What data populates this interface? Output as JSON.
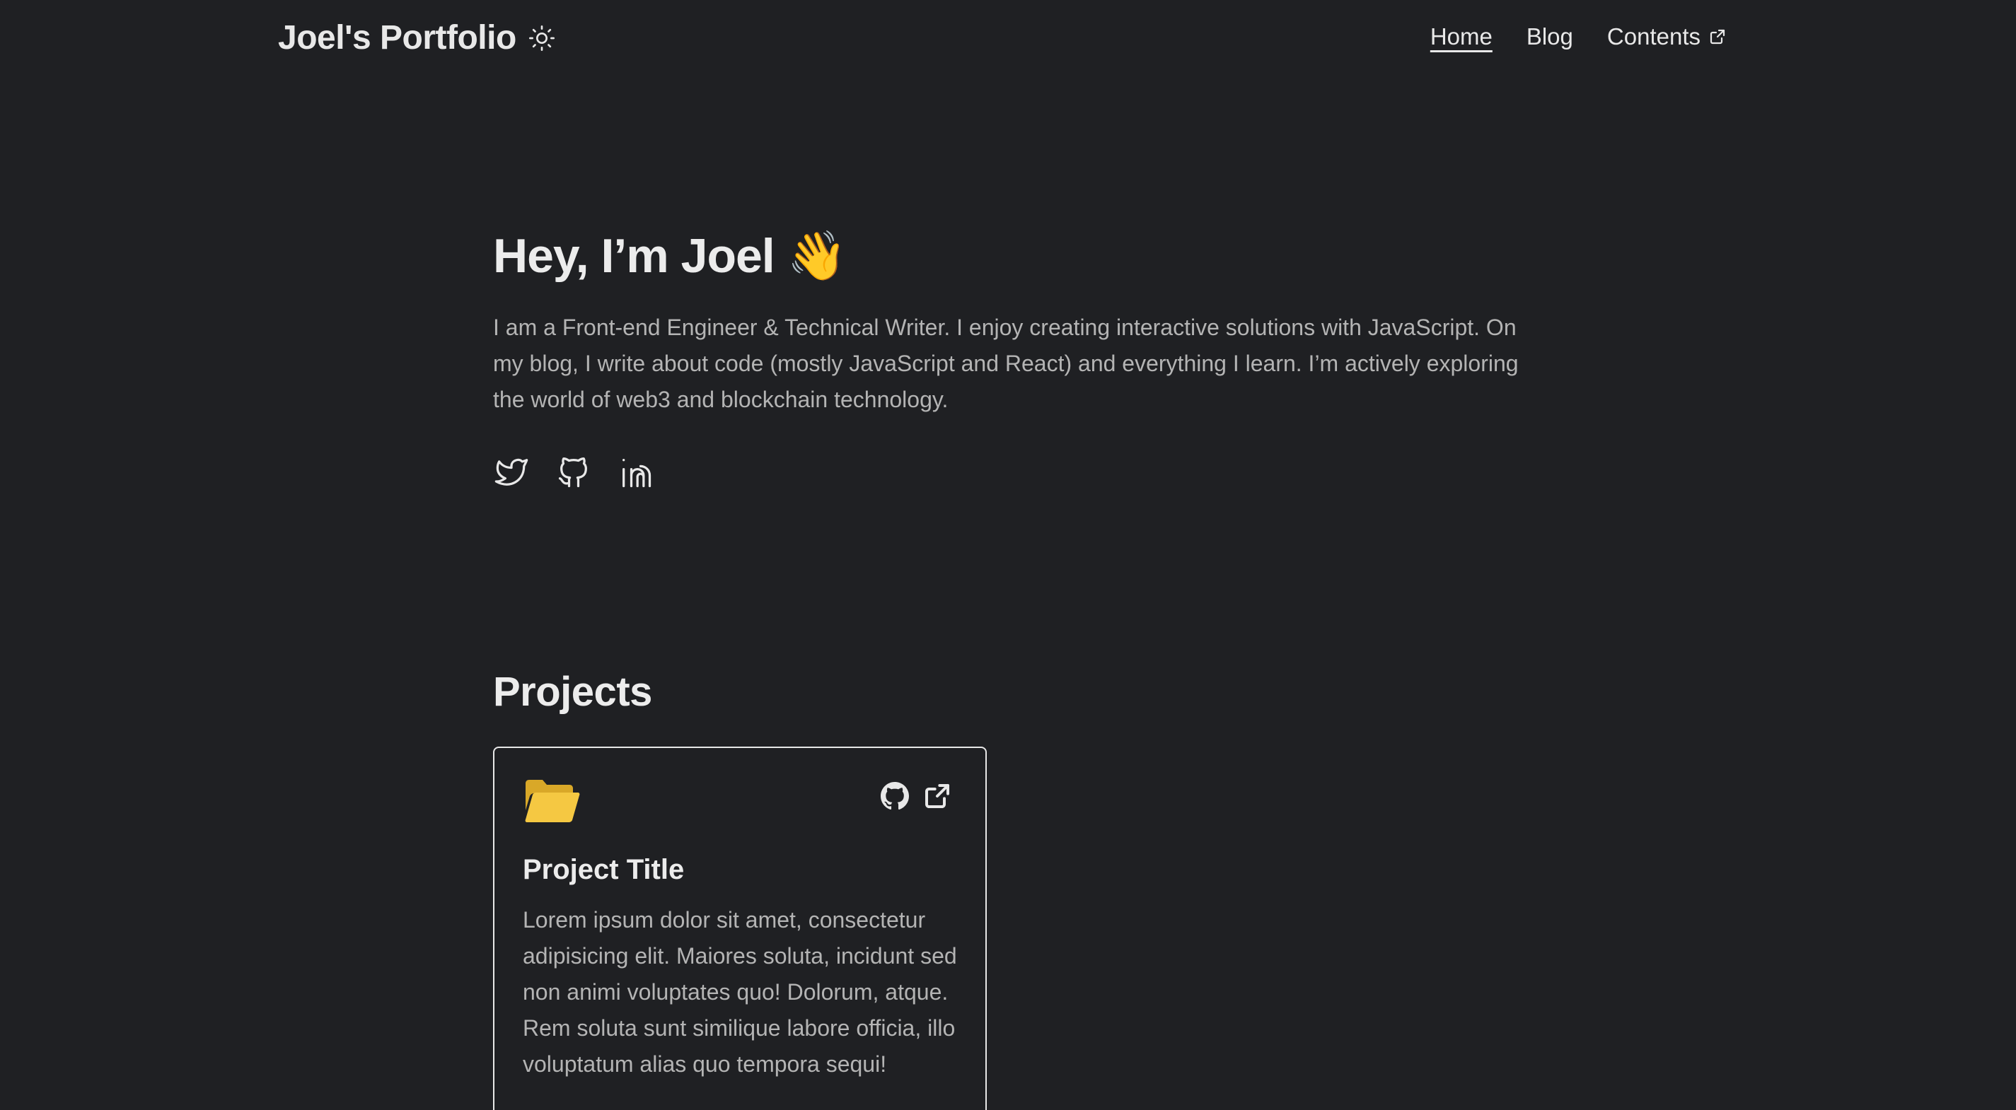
{
  "header": {
    "site_title": "Joel's Portfolio",
    "nav": [
      {
        "label": "Home",
        "active": true
      },
      {
        "label": "Blog",
        "active": false
      },
      {
        "label": "Contents",
        "active": false,
        "external": true
      }
    ]
  },
  "hero": {
    "title": "Hey, I’m Joel 👋",
    "bio": "I am a Front-end Engineer & Technical Writer. I enjoy creating interactive solutions with JavaScript. On my blog, I write about code (mostly JavaScript and React) and everything I learn. I’m actively exploring the world of web3 and blockchain technology.",
    "socials": [
      "twitter-icon",
      "github-icon",
      "linkedin-icon"
    ]
  },
  "projects": {
    "section_title": "Projects",
    "items": [
      {
        "title": "Project Title",
        "description": "Lorem ipsum dolor sit amet, consectetur adipisicing elit. Maiores soluta, incidunt sed non animi voluptates quo! Dolorum, atque. Rem soluta sunt similique labore officia, illo voluptatum alias quo tempora sequi!",
        "icon": "folder-open-icon",
        "icon_color": "#f5c842"
      }
    ]
  },
  "colors": {
    "background": "#1f2023",
    "text": "#e8e8e8",
    "muted_text": "#b4b4b4"
  }
}
